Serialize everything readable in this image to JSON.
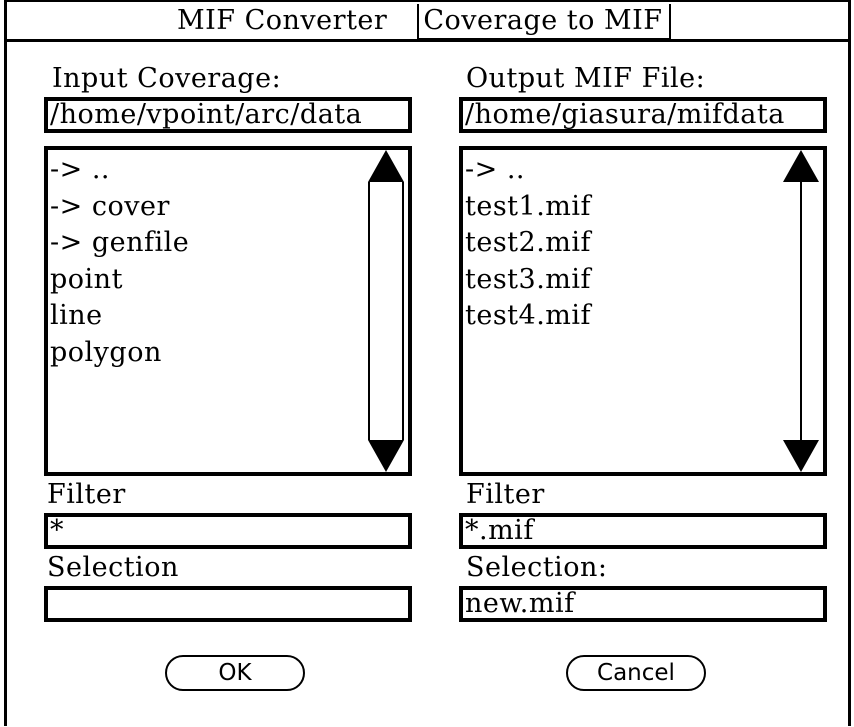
{
  "window": {
    "title": "MIF Converter",
    "mode": "Coverage to MIF"
  },
  "input": {
    "label": "Input Coverage:",
    "path": "/home/vpoint/arc/data",
    "items": [
      "-> ..",
      "-> cover",
      "-> genfile",
      "point",
      "line",
      "polygon"
    ],
    "filter_label": "Filter",
    "filter_value": "*",
    "selection_label": "Selection",
    "selection_value": ""
  },
  "output": {
    "label": "Output MIF File:",
    "path": "/home/giasura/mifdata",
    "items": [
      "-> ..",
      "test1.mif",
      "test2.mif",
      "test3.mif",
      "test4.mif"
    ],
    "filter_label": "Filter",
    "filter_value": "*.mif",
    "selection_label": "Selection:",
    "selection_value": "new.mif"
  },
  "buttons": {
    "ok": "OK",
    "cancel": "Cancel"
  },
  "icons": {
    "scroll_up": "scroll-up-arrow-icon",
    "scroll_down": "scroll-down-arrow-icon"
  }
}
